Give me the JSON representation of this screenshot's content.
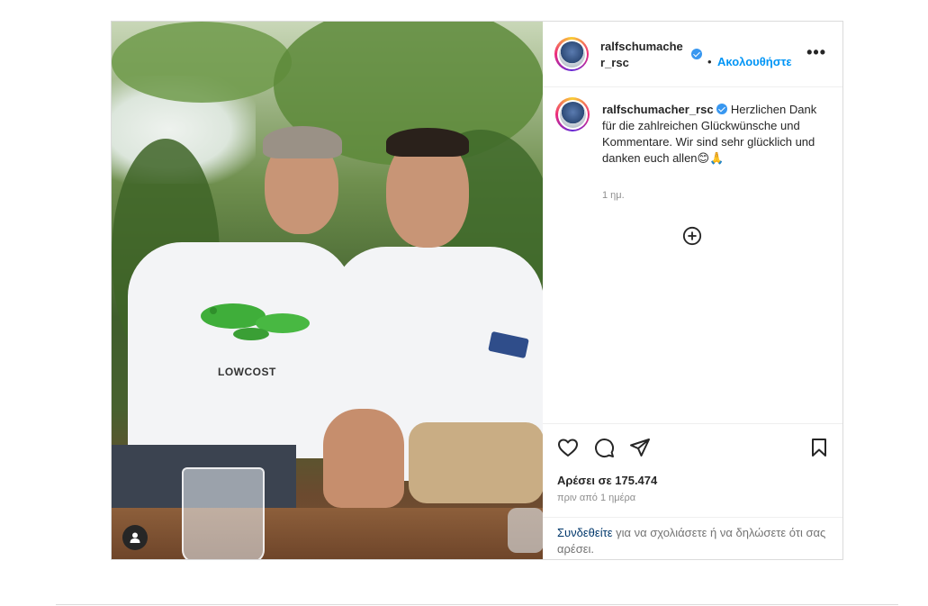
{
  "post": {
    "username_line1": "ralfschumache",
    "username_line2": "r_rsc",
    "follow_separator": "•",
    "follow_label": "Ακολουθήστε",
    "more_label": "•••",
    "caption_username": "ralfschumacher_rsc",
    "caption_text": "Herzlichen Dank für die zahlreichen Glückwünsche und Kommentare. Wir sind sehr glücklich und danken euch allen😊🙏",
    "caption_time": "1 ημ.",
    "likes": "Αρέσει σε 175.474",
    "posted_ago": "πριν από 1 ημέρα",
    "login_link": "Συνδεθείτε",
    "login_rest": " για να σχολιάσετε ή να δηλώσετε ότι σας αρέσει.",
    "photo_shirt_text": "LOWCOST"
  },
  "icons": {
    "like": "heart-icon",
    "comment": "comment-icon",
    "share": "send-icon",
    "save": "bookmark-icon",
    "tag": "user-tag-icon",
    "add": "plus-circle-icon",
    "verified": "verified-badge-icon"
  },
  "colors": {
    "accent": "#0095f6",
    "verified": "#3897f0",
    "link": "#00376b",
    "muted": "#8e8e8e",
    "border": "#dbdbdb"
  }
}
